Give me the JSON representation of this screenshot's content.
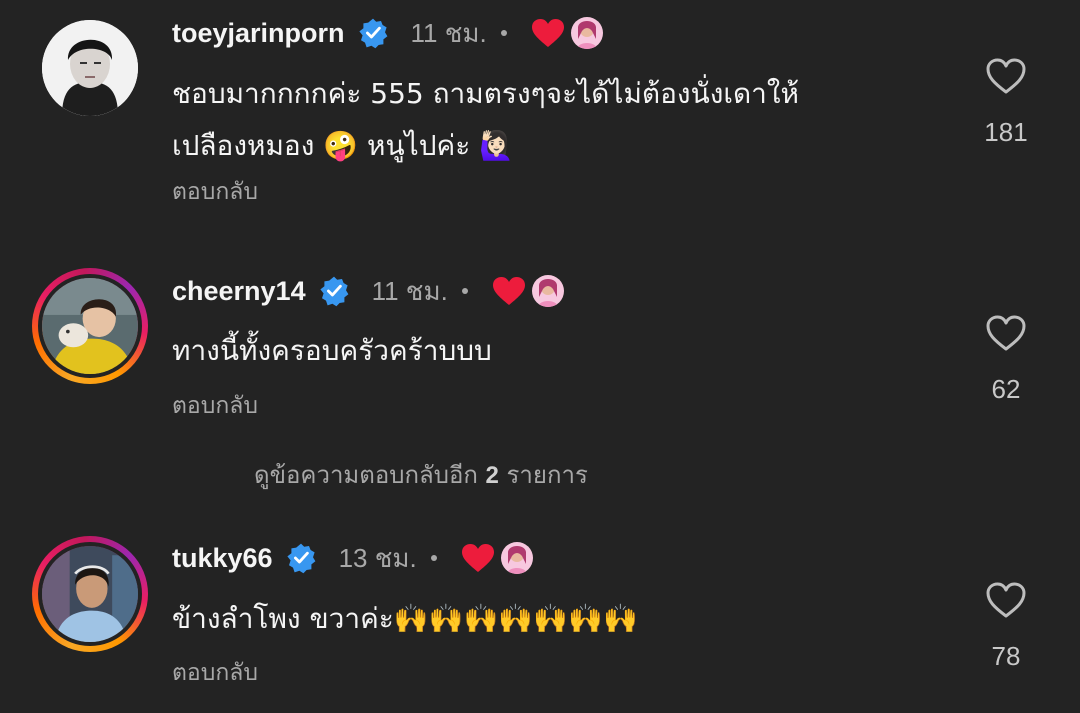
{
  "colors": {
    "background": "#232323",
    "text_primary": "#f5f5f5",
    "text_secondary": "#a8a8a8",
    "verified_blue": "#3897f0",
    "liked_heart": "#ed1c3c"
  },
  "icons": {
    "verified": "verified-badge-icon",
    "author_liked": "red-heart-icon",
    "like": "heart-outline-icon"
  },
  "comments": [
    {
      "username": "toeyjarinporn",
      "time": "11 ชม.",
      "text": "ชอบมากกกกค่ะ 555 ถามตรงๆจะได้ไม่ต้องนั่งเดาให้\nเปลืองหมอง 🤪 หนูไปค่ะ 🙋🏻‍♀️",
      "reply_label": "ตอบกลับ",
      "like_count": "181"
    },
    {
      "username": "cheerny14",
      "time": "11 ชม.",
      "text": "ทางนี้ทั้งครอบครัวคร้าบบบ",
      "reply_label": "ตอบกลับ",
      "like_count": "62"
    },
    {
      "username": "tukky66",
      "time": "13 ชม.",
      "text": "ข้างลำโพง ขวาค่ะ🙌🙌🙌🙌🙌🙌🙌",
      "reply_label": "ตอบกลับ",
      "like_count": "78"
    }
  ],
  "view_replies": {
    "prefix": "ดูข้อความตอบกลับอีก",
    "count": "2",
    "suffix": "รายการ"
  }
}
